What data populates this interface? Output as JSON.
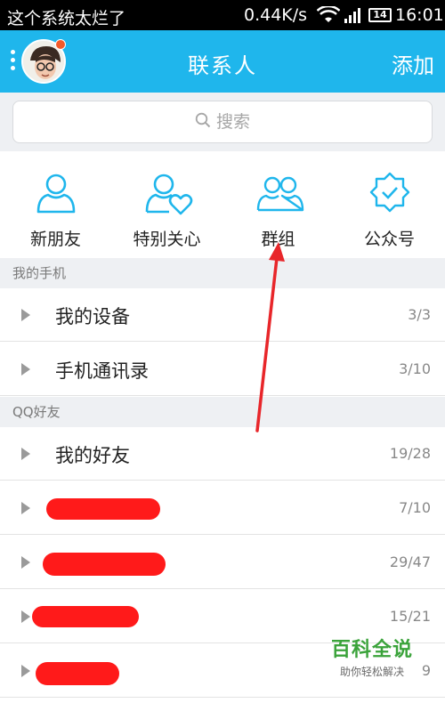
{
  "status_bar": {
    "carrier": "这个系统太烂了",
    "speed": "0.44K/s",
    "battery": "14",
    "time": "16:01"
  },
  "header": {
    "title": "联系人",
    "add_label": "添加"
  },
  "search": {
    "placeholder": "搜索"
  },
  "quick_actions": [
    {
      "label": "新朋友",
      "icon": "new-friend-icon"
    },
    {
      "label": "特别关心",
      "icon": "special-care-icon"
    },
    {
      "label": "群组",
      "icon": "group-icon"
    },
    {
      "label": "公众号",
      "icon": "public-account-icon"
    }
  ],
  "sections": {
    "mine": {
      "title": "我的手机",
      "rows": [
        {
          "name": "我的设备",
          "count": "3/3"
        },
        {
          "name": "手机通讯录",
          "count": "3/10"
        }
      ]
    },
    "qq": {
      "title": "QQ好友",
      "rows": [
        {
          "name": "我的好友",
          "count": "19/28"
        },
        {
          "name": "",
          "count": "7/10"
        },
        {
          "name": "",
          "count": "29/47"
        },
        {
          "name": "",
          "count": "15/21"
        },
        {
          "name": "",
          "count": "9"
        }
      ]
    }
  },
  "watermark": {
    "title": "百科全说",
    "subtitle": "助你轻松解决"
  },
  "colors": {
    "accent": "#1fb6ec",
    "annotation": "#e8262a",
    "redaction": "#ff1a1a"
  }
}
